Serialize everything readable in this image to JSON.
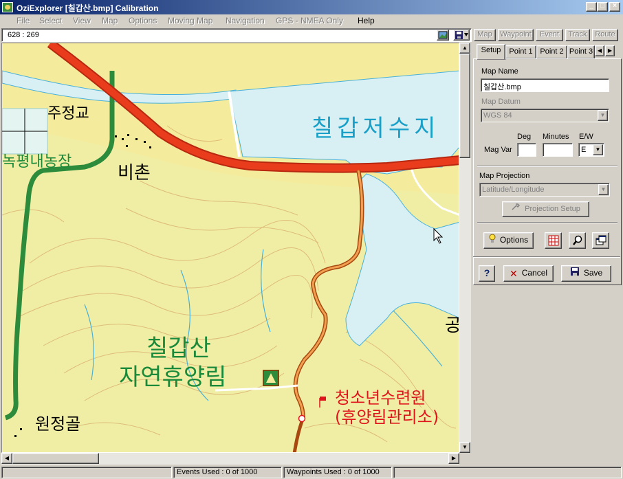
{
  "window": {
    "title": "OziExplorer [칠갑산.bmp] Calibration"
  },
  "menu": {
    "items": [
      "File",
      "Select",
      "View",
      "Map",
      "Options",
      "Moving Map",
      "Navigation",
      "GPS - NMEA Only",
      "Help"
    ],
    "enabled": [
      "Help"
    ]
  },
  "coordbar": {
    "coords": "628 : 269"
  },
  "map": {
    "labels": {
      "reservoir": "칠갑저수지",
      "jujeonggyo": "주정교",
      "nongjang": "녹평내농장",
      "bichon": "비촌",
      "park_line1": "칠갑산",
      "park_line2": "자연휴양림",
      "youth_line1": "청소년수련원",
      "youth_line2": "(휴양림관리소)",
      "wonjeonggol": "원정골",
      "gong": "공"
    },
    "colors": {
      "background": "#f4ec9c",
      "road": "#e83c1c",
      "water": "#d8f0f4",
      "green": "#2c8c3c",
      "label_blue": "#1aa0c8",
      "label_green": "#1a8a3a",
      "label_red": "#e0141c"
    }
  },
  "panel": {
    "top_buttons": [
      "Map",
      "Waypoint",
      "Event",
      "Track",
      "Route"
    ],
    "tabs": [
      "Setup",
      "Point 1",
      "Point 2",
      "Point 3"
    ],
    "active_tab": "Setup",
    "map_name_label": "Map Name",
    "map_name_value": "칠갑산.bmp",
    "map_datum_label": "Map Datum",
    "map_datum_value": "WGS 84",
    "deg_label": "Deg",
    "minutes_label": "Minutes",
    "ew_label": "E/W",
    "magvar_label": "Mag Var",
    "deg_value": "",
    "minutes_value": "",
    "ew_value": "E",
    "projection_label": "Map Projection",
    "projection_value": "Latitude/Longitude",
    "projection_setup_label": "Projection Setup",
    "options_label": "Options",
    "cancel_label": "Cancel",
    "save_label": "Save",
    "help_label": "?"
  },
  "status": {
    "events": "Events Used : 0 of 1000",
    "waypoints": "Waypoints Used : 0 of 1000"
  }
}
